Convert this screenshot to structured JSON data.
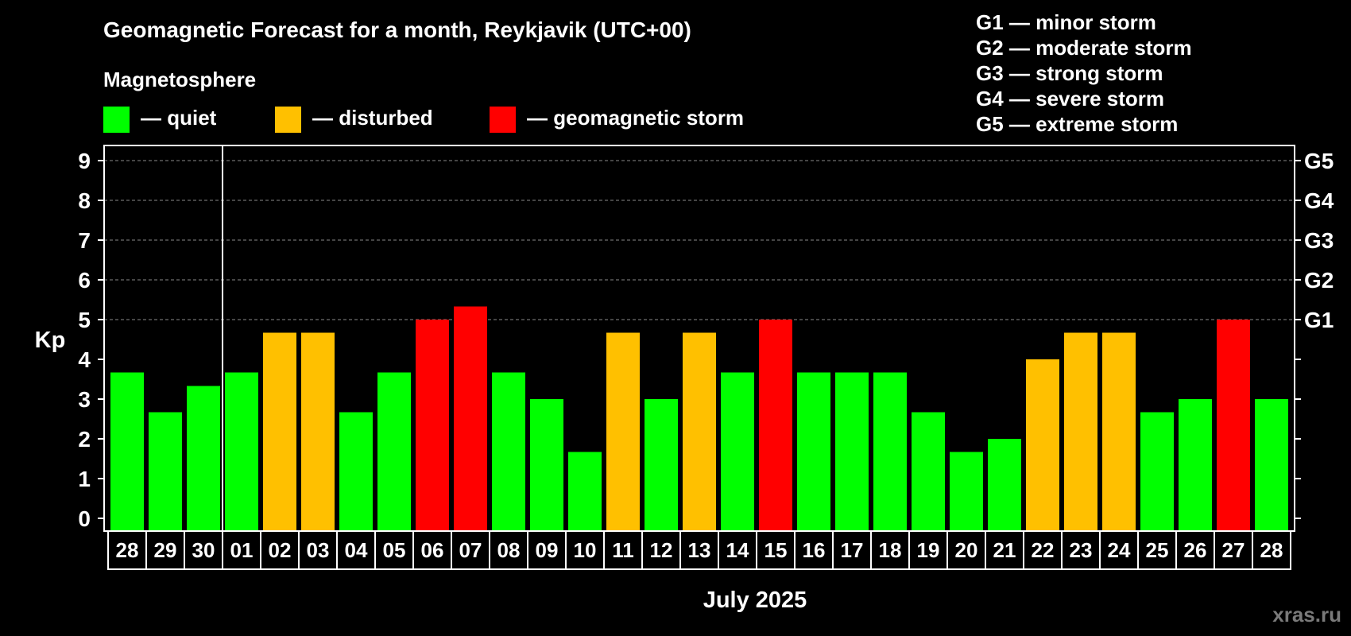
{
  "chart_data": {
    "type": "bar",
    "title": "Geomagnetic Forecast for a month, Reykjavik (UTC+00)",
    "legend_title": "Magnetosphere",
    "legend": [
      {
        "key": "quiet",
        "label": "— quiet",
        "color": "#00ff00"
      },
      {
        "key": "disturbed",
        "label": "— disturbed",
        "color": "#ffc000"
      },
      {
        "key": "storm",
        "label": "— geomagnetic storm",
        "color": "#ff0000"
      }
    ],
    "storm_scale": [
      "G1 — minor storm",
      "G2 — moderate storm",
      "G3 — strong storm",
      "G4 — severe storm",
      "G5 — extreme storm"
    ],
    "ylabel": "Kp",
    "xlabel": "July 2025",
    "ylim": [
      0,
      9
    ],
    "yticks": [
      "0",
      "1",
      "2",
      "3",
      "4",
      "5",
      "6",
      "7",
      "8",
      "9"
    ],
    "right_ticks": [
      {
        "kp": 5,
        "label": "G1"
      },
      {
        "kp": 6,
        "label": "G2"
      },
      {
        "kp": 7,
        "label": "G3"
      },
      {
        "kp": 8,
        "label": "G4"
      },
      {
        "kp": 9,
        "label": "G5"
      }
    ],
    "grid": "dashed horizontal at Kp 5–9",
    "month_divider_after_index": 2,
    "categories": [
      "28",
      "29",
      "30",
      "01",
      "02",
      "03",
      "04",
      "05",
      "06",
      "07",
      "08",
      "09",
      "10",
      "11",
      "12",
      "13",
      "14",
      "15",
      "16",
      "17",
      "18",
      "19",
      "20",
      "21",
      "22",
      "23",
      "24",
      "25",
      "26",
      "27",
      "28"
    ],
    "values": [
      3.67,
      2.67,
      3.33,
      3.67,
      4.67,
      4.67,
      2.67,
      3.67,
      5,
      5.33,
      3.67,
      3,
      1.67,
      4.67,
      3,
      4.67,
      3.67,
      5,
      3.67,
      3.67,
      3.67,
      2.67,
      1.67,
      2,
      4,
      4.67,
      4.67,
      2.67,
      3,
      5,
      3
    ],
    "levels": [
      "quiet",
      "quiet",
      "quiet",
      "quiet",
      "disturbed",
      "disturbed",
      "quiet",
      "quiet",
      "storm",
      "storm",
      "quiet",
      "quiet",
      "quiet",
      "disturbed",
      "quiet",
      "disturbed",
      "quiet",
      "storm",
      "quiet",
      "quiet",
      "quiet",
      "quiet",
      "quiet",
      "quiet",
      "disturbed",
      "disturbed",
      "disturbed",
      "quiet",
      "quiet",
      "storm",
      "quiet"
    ]
  },
  "watermark": "xras.ru"
}
